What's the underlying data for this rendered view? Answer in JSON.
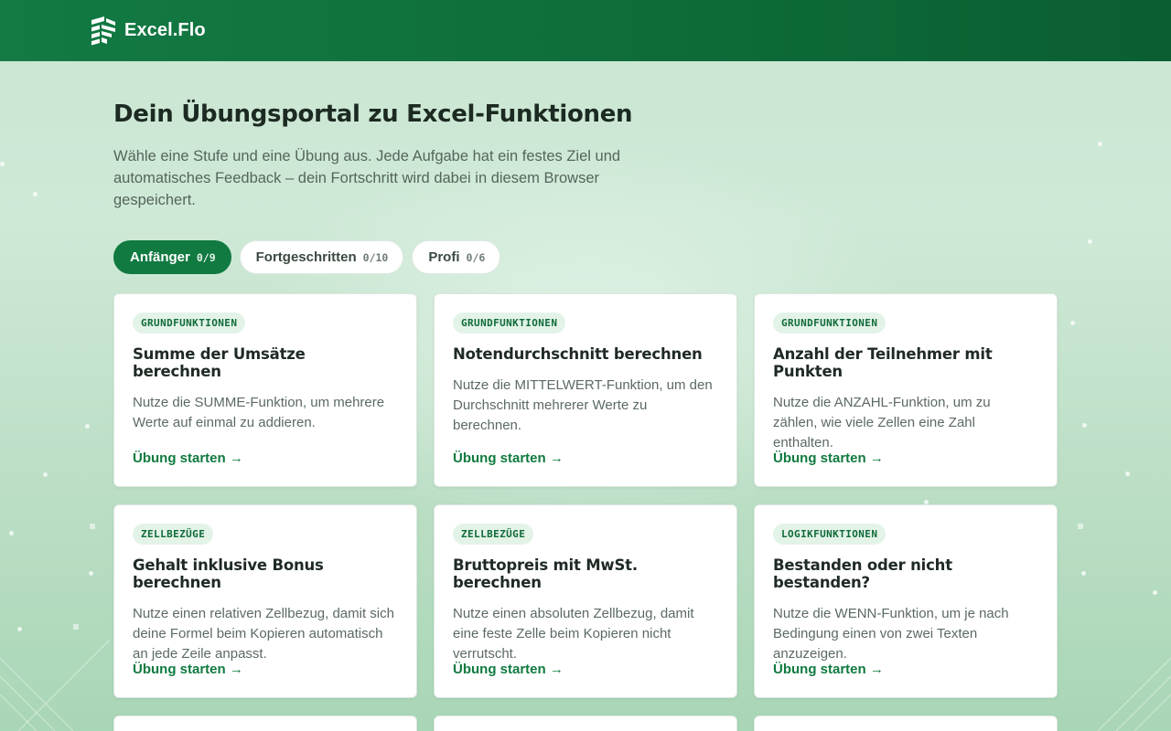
{
  "header": {
    "brand_name": "Excel.Flo",
    "logo_icon": "excelflo-logo-icon"
  },
  "page": {
    "title": "Dein Übungsportal zu Excel-Funktionen",
    "intro": "Wähle eine Stufe und eine Übung aus. Jede Aufgabe hat ein festes Ziel und automatisches Feedback – dein Fortschritt wird dabei in diesem Browser gespeichert."
  },
  "colors": {
    "brand_green": "#117a41",
    "badge_bg": "#e3f3e8",
    "link_green": "#0f7a3f"
  },
  "tabs": [
    {
      "label": "Anfänger",
      "count": "0/9",
      "active": true
    },
    {
      "label": "Fortgeschritten",
      "count": "0/10",
      "active": false
    },
    {
      "label": "Profi",
      "count": "0/6",
      "active": false
    }
  ],
  "cards": [
    {
      "badge": "GRUNDFUNKTIONEN",
      "title": "Summe der Umsätze berechnen",
      "description": "Nutze die SUMME-Funktion, um mehrere Werte auf einmal zu addieren.",
      "link": "Übung starten →"
    },
    {
      "badge": "GRUNDFUNKTIONEN",
      "title": "Notendurchschnitt berechnen",
      "description": "Nutze die MITTELWERT-Funktion, um den Durchschnitt mehrerer Werte zu berechnen.",
      "link": "Übung starten →"
    },
    {
      "badge": "GRUNDFUNKTIONEN",
      "title": "Anzahl der Teilnehmer mit Punkten",
      "description": "Nutze die ANZAHL-Funktion, um zu zählen, wie viele Zellen eine Zahl enthalten.",
      "link": "Übung starten →"
    },
    {
      "badge": "ZELLBEZÜGE",
      "title": "Gehalt inklusive Bonus berechnen",
      "description": "Nutze einen relativen Zellbezug, damit sich deine Formel beim Kopieren automatisch an jede Zeile anpasst.",
      "link": "Übung starten →"
    },
    {
      "badge": "ZELLBEZÜGE",
      "title": "Bruttopreis mit MwSt. berechnen",
      "description": "Nutze einen absoluten Zellbezug, damit eine feste Zelle beim Kopieren nicht verrutscht.",
      "link": "Übung starten →"
    },
    {
      "badge": "LOGIKFUNKTIONEN",
      "title": "Bestanden oder nicht bestanden?",
      "description": "Nutze die WENN-Funktion, um je nach Bedingung einen von zwei Texten anzuzeigen.",
      "link": "Übung starten →"
    }
  ]
}
